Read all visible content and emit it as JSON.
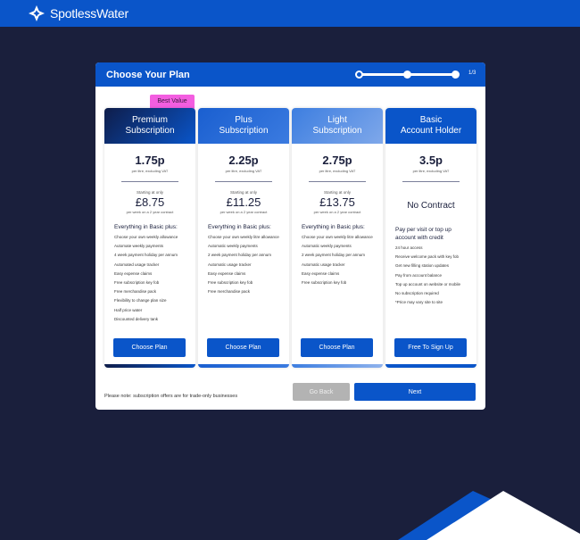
{
  "brand": {
    "name": "SpotlessWater",
    "logo_icon": "four-point-star-icon",
    "color": "#0a55c9"
  },
  "panel": {
    "title": "Choose Your Plan",
    "step_text": "1/3",
    "steps_total": 3,
    "current_step": 1
  },
  "badge": {
    "label": "Best Value",
    "color": "#f35ee0"
  },
  "plans": [
    {
      "name_line1": "Premium",
      "name_line2": "Subscription",
      "price": "1.75p",
      "price_note": "per litre, excluding VAT",
      "start_label": "Starting at only",
      "weekly": "£8.75",
      "weekly_note": "per week on a 2 year contract",
      "features_title": "Everything in Basic plus:",
      "features": [
        "Choose your own weekly allowance",
        "Automate weekly payments",
        "4 week payment holiday per annum",
        "Automated usage tracker",
        "Easy expense claims",
        "Free subscription key fob",
        "Free merchandise pack",
        "Flexibility to change plan size",
        "Half price water",
        "Discounted delivery tank"
      ],
      "button": "Choose Plan"
    },
    {
      "name_line1": "Plus",
      "name_line2": "Subscription",
      "price": "2.25p",
      "price_note": "per litre, excluding VAT",
      "start_label": "Starting at only",
      "weekly": "£11.25",
      "weekly_note": "per week on a 2 year contract",
      "features_title": "Everything in Basic plus:",
      "features": [
        "Choose your own weekly litre allowance",
        "Automatic weekly payments",
        "2 week payment holiday per annum",
        "Automatic usage tracker",
        "Easy expense claims",
        "Free subscription key fob",
        "Free merchandise pack"
      ],
      "button": "Choose Plan"
    },
    {
      "name_line1": "Light",
      "name_line2": "Subscription",
      "price": "2.75p",
      "price_note": "per litre, excluding VAT",
      "start_label": "Starting at only",
      "weekly": "£13.75",
      "weekly_note": "per week on a 2 year contract",
      "features_title": "Everything in Basic plus:",
      "features": [
        "Choose your own weekly litre allowance",
        "Automatic weekly payments",
        "2 week payment holiday per annum",
        "Automatic usage tracker",
        "Easy expense claims",
        "Free subscription key fob"
      ],
      "button": "Choose Plan"
    },
    {
      "name_line1": "Basic",
      "name_line2": "Account Holder",
      "price": "3.5p",
      "price_note": "per litre, excluding VAT",
      "no_contract": "No Contract",
      "features_title": "Pay per visit or top up account with credit",
      "features": [
        "24 hour access",
        "Receive welcome pack with key fob",
        "Get new filling station updates",
        "Pay from account balance",
        "Top up account on website or mobile",
        "No subscription required",
        "*Price may vary site to site"
      ],
      "button": "Free To Sign Up"
    }
  ],
  "footer": {
    "note": "Please note: subscription offers are for trade-only businesses",
    "back_label": "Go Back",
    "next_label": "Next"
  }
}
